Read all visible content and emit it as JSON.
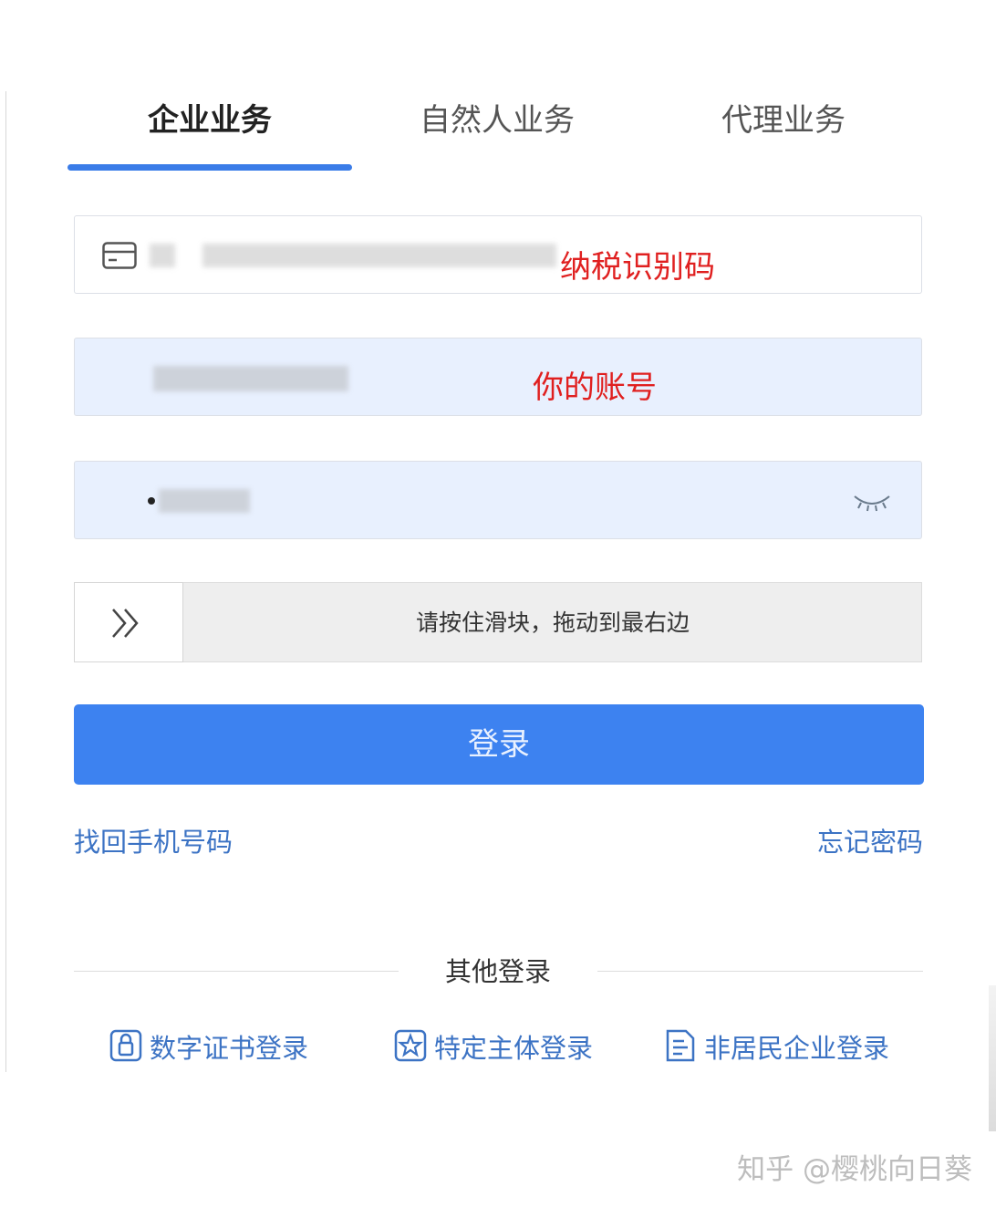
{
  "tabs": [
    {
      "label": "企业业务",
      "active": true
    },
    {
      "label": "自然人业务",
      "active": false
    },
    {
      "label": "代理业务",
      "active": false
    }
  ],
  "fields": {
    "tax_id": {
      "annotation": "纳税识别码"
    },
    "account": {
      "annotation": "你的账号"
    },
    "password": {
      "masked_char": "•"
    }
  },
  "slider": {
    "text": "请按住滑块，拖动到最右边"
  },
  "login_button": {
    "label": "登录"
  },
  "links": {
    "recover_phone": "找回手机号码",
    "forgot_password": "忘记密码"
  },
  "other_login": {
    "title": "其他登录",
    "options": [
      {
        "label": "数字证书登录",
        "icon": "certificate-icon"
      },
      {
        "label": "特定主体登录",
        "icon": "star-badge-icon"
      },
      {
        "label": "非居民企业登录",
        "icon": "document-icon"
      }
    ]
  },
  "watermark": "知乎 @樱桃向日葵",
  "colors": {
    "accent": "#3d82f0",
    "link": "#3c73c4",
    "annotation": "#e02020",
    "filled_field": "#e8f0fe"
  }
}
